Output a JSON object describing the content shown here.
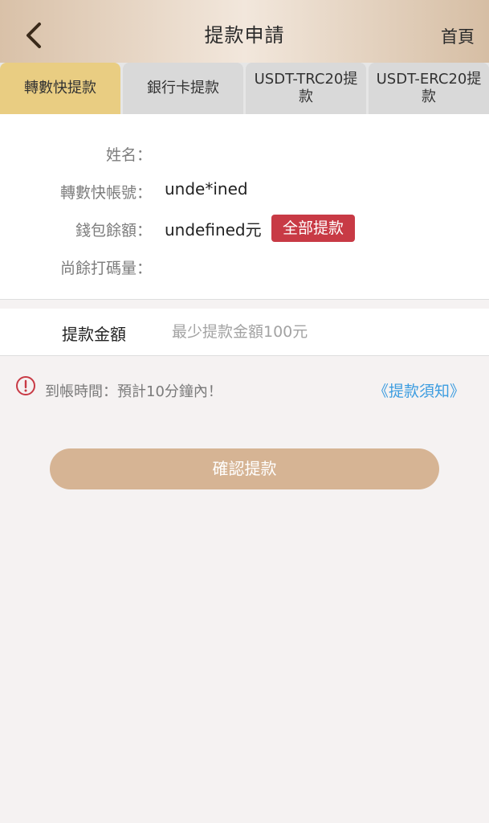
{
  "header": {
    "title": "提款申請",
    "home_label": "首頁"
  },
  "tabs": [
    {
      "label": "轉數快提款",
      "active": true
    },
    {
      "label": "銀行卡提款",
      "active": false
    },
    {
      "label": "USDT-TRC20提款",
      "active": false
    },
    {
      "label": "USDT-ERC20提款",
      "active": false
    }
  ],
  "info": {
    "name_label": "姓名：",
    "name_value": "",
    "account_label": "轉數快帳號：",
    "account_value": "unde*ined",
    "balance_label": "錢包餘額：",
    "balance_value": "undefined元",
    "withdraw_all_label": "全部提款",
    "remaining_label": "尚餘打碼量：",
    "remaining_value": ""
  },
  "amount": {
    "label": "提款金額",
    "placeholder": "最少提款金額100元"
  },
  "notice": {
    "text": "到帳時間：預計10分鐘內！",
    "link": "《提款須知》"
  },
  "confirm_label": "確認提款",
  "colors": {
    "active_tab": "#e9cd82",
    "withdraw_all": "#c83a45",
    "confirm": "#d6b494",
    "link": "#3d9de0",
    "warning": "#c83a45"
  }
}
